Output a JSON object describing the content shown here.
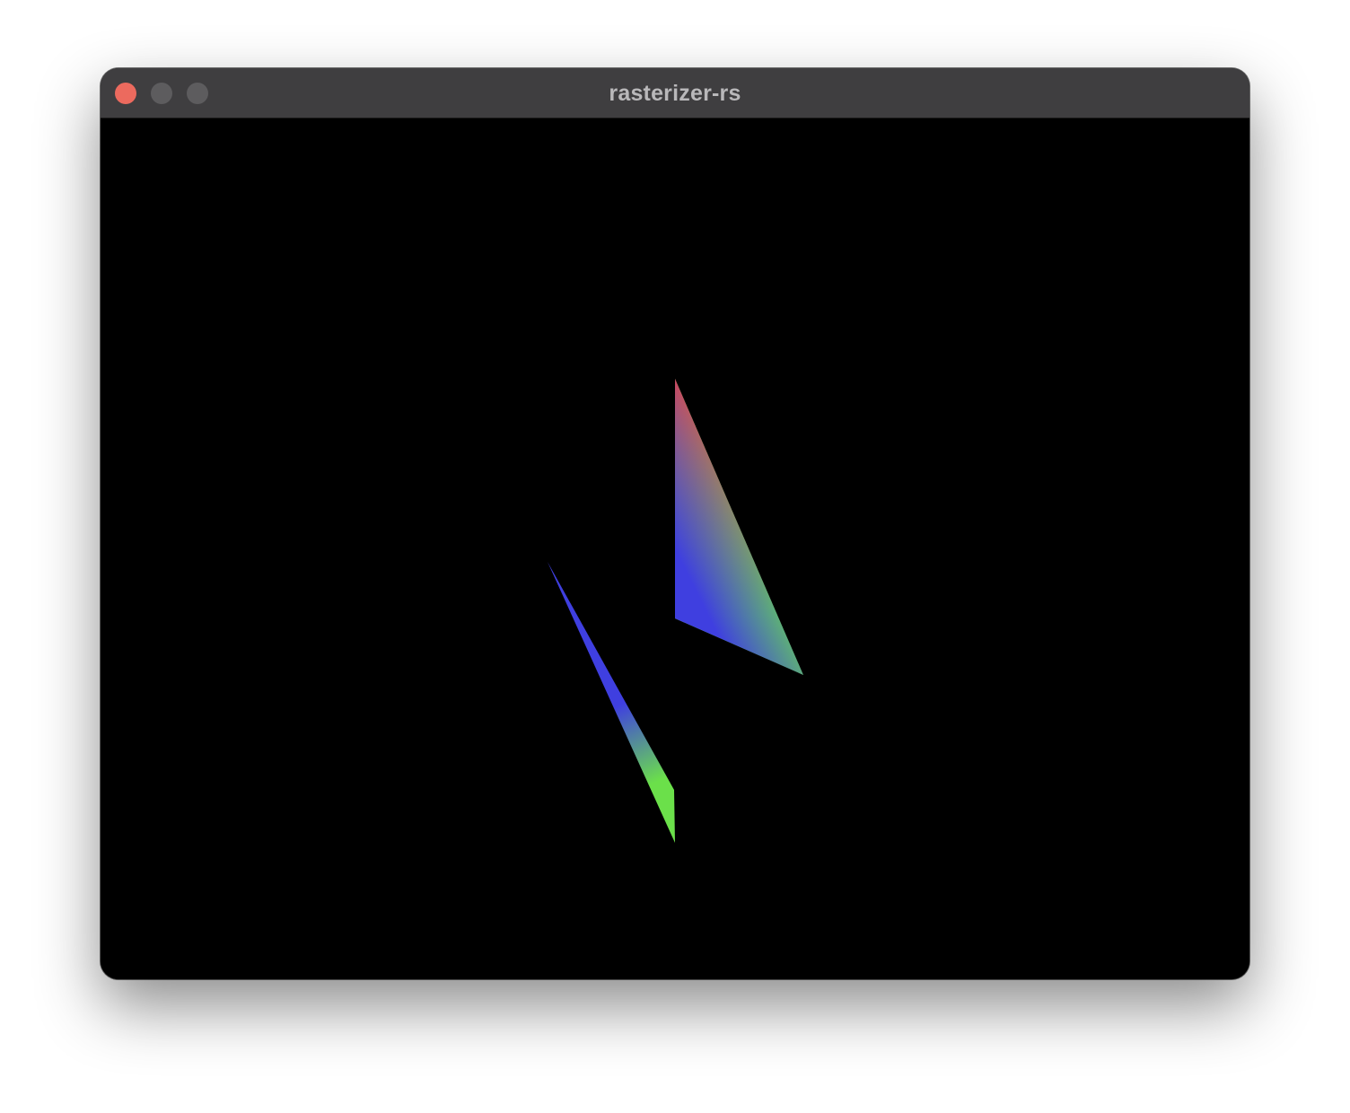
{
  "window": {
    "title": "rasterizer-rs"
  },
  "traffic_lights": {
    "close": {
      "color": "#ec6a5e"
    },
    "minimize": {
      "color": "#5d5c5e"
    },
    "zoom": {
      "color": "#5d5c5e"
    }
  },
  "scene": {
    "background": "#000000",
    "vertex_colors": {
      "red": "#e24a4a",
      "green": "#6be04a",
      "blue": "#3f3fe0"
    }
  }
}
